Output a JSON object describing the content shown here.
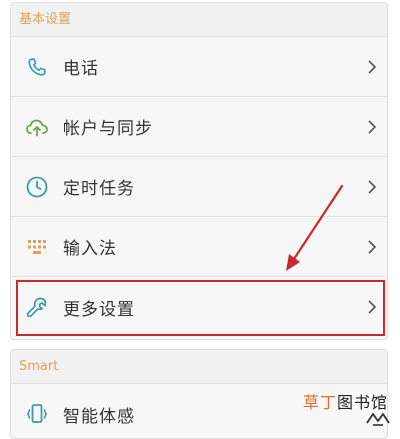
{
  "sections": {
    "basic": {
      "header": "基本设置",
      "items": [
        {
          "label": "电话",
          "icon": "phone-icon"
        },
        {
          "label": "帐户与同步",
          "icon": "cloud-sync-icon"
        },
        {
          "label": "定时任务",
          "icon": "clock-icon"
        },
        {
          "label": "输入法",
          "icon": "keypad-icon"
        },
        {
          "label": "更多设置",
          "icon": "wrench-icon"
        }
      ]
    },
    "smart": {
      "header": "Smart",
      "items": [
        {
          "label": "智能体感",
          "icon": "phone-motion-icon"
        }
      ]
    }
  },
  "watermark": {
    "text_a": "草丁",
    "text_b": "图书馆"
  },
  "colors": {
    "section_header": "#e3a05a",
    "highlight": "#c8282e",
    "icon_teal": "#3a9aa8",
    "icon_green": "#6aa843"
  }
}
